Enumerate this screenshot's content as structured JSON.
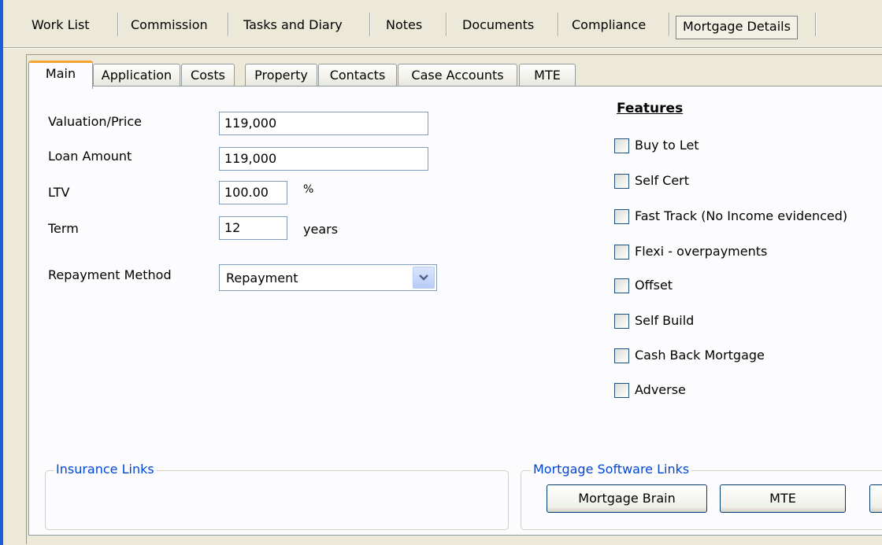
{
  "top_nav": {
    "items": [
      "Work List",
      "Commission",
      "Tasks and Diary",
      "Notes",
      "Documents",
      "Compliance",
      "Mortgage Details"
    ],
    "active": "Mortgage Details"
  },
  "tabs": {
    "items": [
      "Main",
      "Application",
      "Costs",
      "Property",
      "Contacts",
      "Case Accounts",
      "MTE"
    ],
    "active": "Main"
  },
  "form": {
    "valuation_label": "Valuation/Price",
    "valuation_value": "119,000",
    "loan_label": "Loan Amount",
    "loan_value": "119,000",
    "ltv_label": "LTV",
    "ltv_value": "100.00",
    "ltv_unit": "%",
    "term_label": "Term",
    "term_value": "12",
    "term_unit": "years",
    "repayment_label": "Repayment Method",
    "repayment_value": "Repayment"
  },
  "features": {
    "title": "Features",
    "items": [
      "Buy to Let",
      "Self Cert",
      "Fast Track (No Income evidenced)",
      "Flexi - overpayments",
      "Offset",
      "Self Build",
      "Cash Back Mortgage",
      "Adverse"
    ]
  },
  "insurance_links": {
    "title": "Insurance Links"
  },
  "mortgage_software_links": {
    "title": "Mortgage Software Links",
    "buttons": [
      "Mortgage Brain",
      "MTE"
    ]
  }
}
